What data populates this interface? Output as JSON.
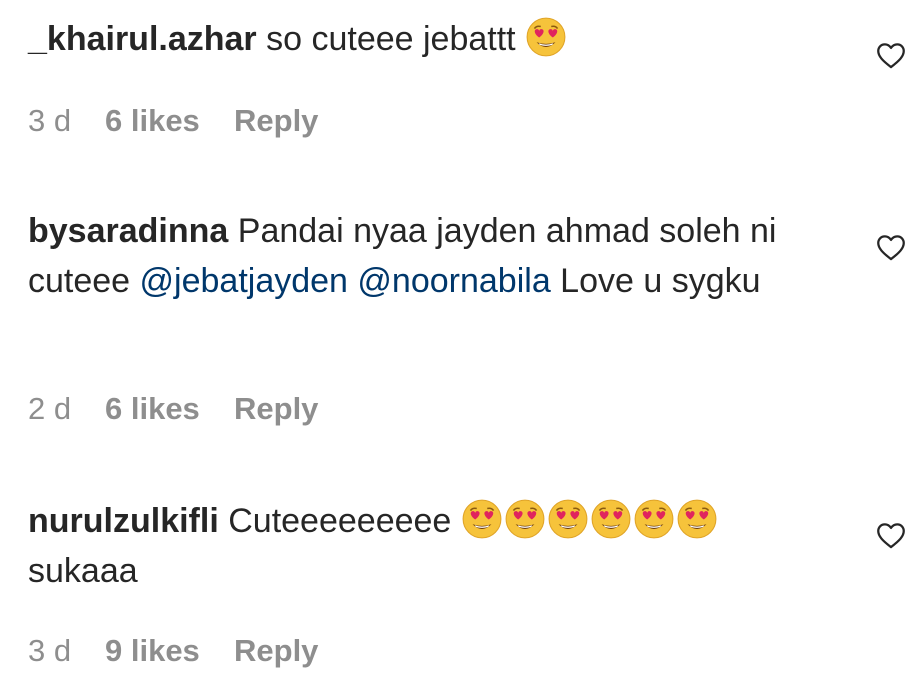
{
  "comments": [
    {
      "username": "_khairul.azhar",
      "text": "so cuteee jebattt",
      "emoji_count": 1,
      "emoji": "heart-eyes-face-emoji",
      "age": "3 d",
      "likes": "6 likes",
      "reply": "Reply"
    },
    {
      "username": "bysaradinna",
      "text_parts": [
        "Pandai nyaa jayden ahmad soleh ni cuteee ",
        "@jebatjayden",
        " ",
        "@noornabila",
        " Love u sygku"
      ],
      "age": "2 d",
      "likes": "6 likes",
      "reply": "Reply"
    },
    {
      "username": "nurulzulkifli",
      "text_before": "Cuteeeeeeeee",
      "emoji_count": 6,
      "emoji": "heart-eyes-face-emoji",
      "text_after": "sukaaa",
      "age": "3 d",
      "likes": "9 likes",
      "reply": "Reply"
    }
  ],
  "icons": {
    "like": "heart-outline-icon"
  },
  "colors": {
    "text": "#262626",
    "meta": "#8e8e8e",
    "mention": "#00376b",
    "emoji_face": "#f6c33b",
    "emoji_heart": "#e0245e"
  }
}
